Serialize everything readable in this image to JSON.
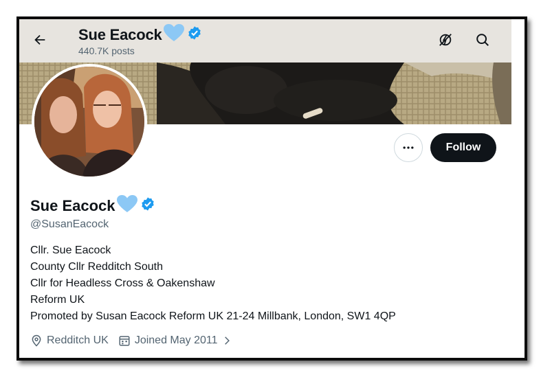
{
  "header": {
    "back_icon": "arrow-left-icon",
    "name": "Sue Eacock",
    "posts": "440.7K posts",
    "heart_color": "#8cc8f5",
    "verified_color": "#1d9bf0",
    "actions": [
      "bolt-off-icon",
      "search-icon"
    ]
  },
  "profile": {
    "name": "Sue Eacock",
    "handle": "@SusanEacock",
    "bio": [
      "Cllr. Sue Eacock",
      "County Cllr Redditch South",
      "Cllr for Headless Cross & Oakenshaw",
      "Reform UK",
      "Promoted by Susan Eacock Reform UK 21-24 Millbank, London, SW1 4QP"
    ],
    "location": "Redditch UK",
    "joined": "Joined May 2011",
    "follow_label": "Follow",
    "more_icon": "more-horizontal-icon"
  }
}
